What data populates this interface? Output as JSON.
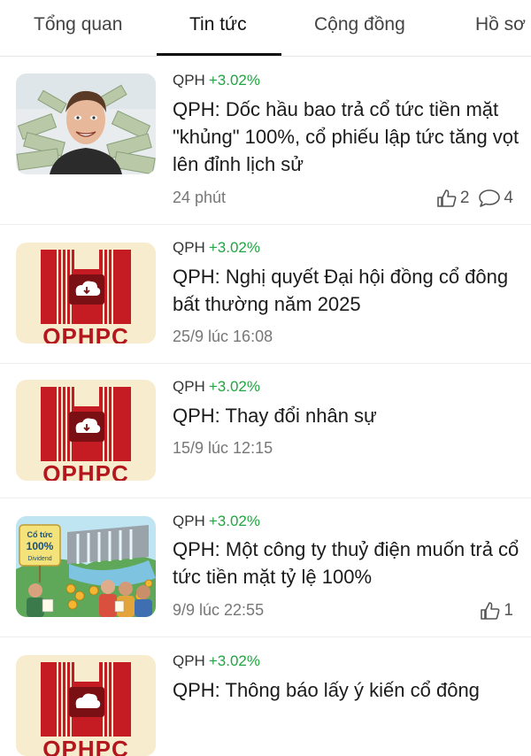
{
  "tabs": [
    {
      "label": "Tổng quan"
    },
    {
      "label": "Tin tức"
    },
    {
      "label": "Cộng đồng"
    },
    {
      "label": "Hồ sơ"
    }
  ],
  "colors": {
    "positive": "#1fa642",
    "logo_red": "#b3171e"
  },
  "news": [
    {
      "ticker": "QPH",
      "change": "+3.02%",
      "title": "QPH: Dốc hầu bao trả cổ tức tiền mặt \"khủng\" 100%, cổ phiếu lập tức tăng vọt lên đỉnh lịch sử",
      "time": "24 phút",
      "likes": "2",
      "comments": "4",
      "thumbnail": "man-with-money-photo"
    },
    {
      "ticker": "QPH",
      "change": "+3.02%",
      "title": "QPH: Nghị quyết Đại hội đồng cổ đông bất thường năm 2025",
      "time": "25/9 lúc 16:08",
      "thumbnail": "qphpc-logo",
      "logo_text": "QPHPC"
    },
    {
      "ticker": "QPH",
      "change": "+3.02%",
      "title": "QPH: Thay đổi nhân sự",
      "time": "15/9 lúc 12:15",
      "thumbnail": "qphpc-logo",
      "logo_text": "QPHPC"
    },
    {
      "ticker": "QPH",
      "change": "+3.02%",
      "title": "QPH: Một công ty thuỷ điện muốn trả cổ tức tiền mặt tỷ lệ 100%",
      "time": "9/9 lúc 22:55",
      "likes": "1",
      "thumbnail": "dividend-illustration",
      "thumb_sign_line1": "Cổ tức",
      "thumb_sign_line2": "100%",
      "thumb_sign_line3": "Dividend"
    },
    {
      "ticker": "QPH",
      "change": "+3.02%",
      "title": "QPH: Thông báo lấy ý kiến cổ đông",
      "thumbnail": "qphpc-logo",
      "logo_text": "QPHPC"
    }
  ]
}
